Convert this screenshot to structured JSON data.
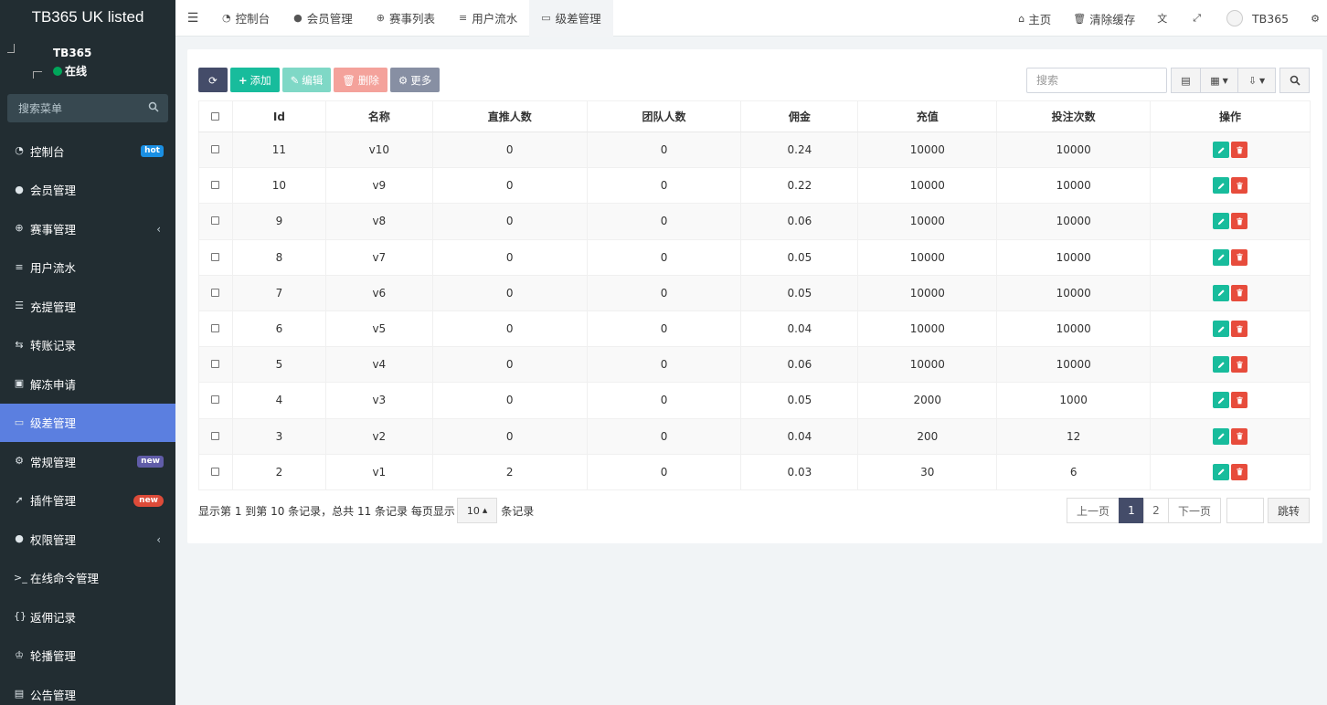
{
  "app": {
    "title": "TB365 UK listed"
  },
  "user": {
    "name": "TB365",
    "status": "在线"
  },
  "sidebar": {
    "search_placeholder": "搜索菜单",
    "items": [
      {
        "label": "控制台",
        "icon": "dashboard-icon",
        "glyph": "◔",
        "badge": "hot"
      },
      {
        "label": "会员管理",
        "icon": "users-icon",
        "glyph": "●"
      },
      {
        "label": "赛事管理",
        "icon": "globe-icon",
        "glyph": "⊕",
        "caret": "‹"
      },
      {
        "label": "用户流水",
        "icon": "list-icon",
        "glyph": "≡"
      },
      {
        "label": "充提管理",
        "icon": "list-alt-icon",
        "glyph": "☰"
      },
      {
        "label": "转账记录",
        "icon": "exchange-icon",
        "glyph": "⇆"
      },
      {
        "label": "解冻申请",
        "icon": "image-icon",
        "glyph": "▣"
      },
      {
        "label": "级差管理",
        "icon": "window-icon",
        "glyph": "▭",
        "active": true
      },
      {
        "label": "常规管理",
        "icon": "cogs-icon",
        "glyph": "⚙",
        "badge": "new"
      },
      {
        "label": "插件管理",
        "icon": "rocket-icon",
        "glyph": "➚",
        "badge": "new"
      },
      {
        "label": "权限管理",
        "icon": "group-icon",
        "glyph": "●",
        "caret": "‹"
      },
      {
        "label": "在线命令管理",
        "icon": "terminal-icon",
        "glyph": ">_"
      },
      {
        "label": "返佣记录",
        "icon": "code-icon",
        "glyph": "{}"
      },
      {
        "label": "轮播管理",
        "icon": "slides-icon",
        "glyph": "♔"
      },
      {
        "label": "公告管理",
        "icon": "bullhorn-icon",
        "glyph": "▤"
      }
    ]
  },
  "topbar": {
    "tabs": [
      {
        "label": "控制台",
        "icon": "dashboard-icon",
        "glyph": "◔"
      },
      {
        "label": "会员管理",
        "icon": "users-icon",
        "glyph": "●"
      },
      {
        "label": "赛事列表",
        "icon": "globe-icon",
        "glyph": "⊕"
      },
      {
        "label": "用户流水",
        "icon": "list-icon",
        "glyph": "≡"
      },
      {
        "label": "级差管理",
        "icon": "window-icon",
        "glyph": "▭",
        "active": true
      }
    ],
    "home": "主页",
    "clear_cache": "清除缓存",
    "username": "TB365"
  },
  "toolbar": {
    "add": "添加",
    "edit": "编辑",
    "delete": "删除",
    "more": "更多",
    "search_placeholder": "搜索"
  },
  "table": {
    "columns": [
      "Id",
      "名称",
      "直推人数",
      "团队人数",
      "佣金",
      "充值",
      "投注次数",
      "操作"
    ],
    "rows": [
      [
        "11",
        "v10",
        "0",
        "0",
        "0.24",
        "10000",
        "10000"
      ],
      [
        "10",
        "v9",
        "0",
        "0",
        "0.22",
        "10000",
        "10000"
      ],
      [
        "9",
        "v8",
        "0",
        "0",
        "0.06",
        "10000",
        "10000"
      ],
      [
        "8",
        "v7",
        "0",
        "0",
        "0.05",
        "10000",
        "10000"
      ],
      [
        "7",
        "v6",
        "0",
        "0",
        "0.05",
        "10000",
        "10000"
      ],
      [
        "6",
        "v5",
        "0",
        "0",
        "0.04",
        "10000",
        "10000"
      ],
      [
        "5",
        "v4",
        "0",
        "0",
        "0.06",
        "10000",
        "10000"
      ],
      [
        "4",
        "v3",
        "0",
        "0",
        "0.05",
        "2000",
        "1000"
      ],
      [
        "3",
        "v2",
        "0",
        "0",
        "0.04",
        "200",
        "12"
      ],
      [
        "2",
        "v1",
        "2",
        "0",
        "0.03",
        "30",
        "6"
      ]
    ]
  },
  "pagination": {
    "info": "显示第 1 到第 10 条记录，总共 11 条记录 每页显示",
    "page_size": "10",
    "suffix": "条记录",
    "prev": "上一页",
    "pages": [
      "1",
      "2"
    ],
    "current": "1",
    "next": "下一页",
    "jump": "跳转"
  },
  "colors": {
    "sidebar_bg": "#222d32",
    "active": "#5b7fe0",
    "primary": "#18bc9c",
    "danger": "#e74c3c"
  }
}
